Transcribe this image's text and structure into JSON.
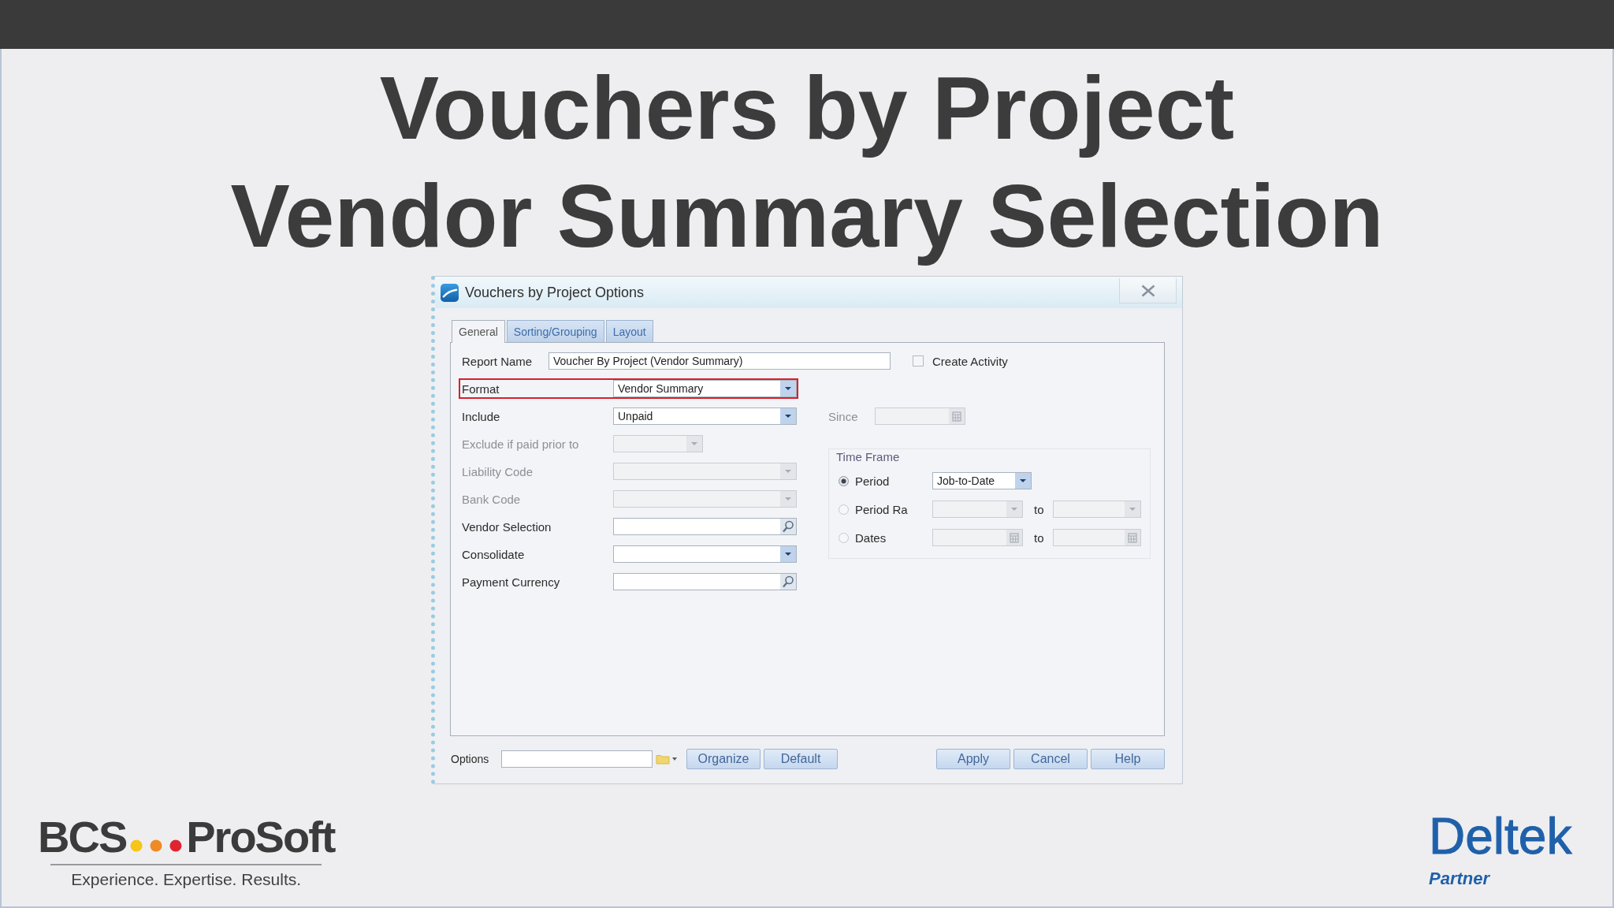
{
  "slide": {
    "title": [
      "Vouchers by Project",
      "Vendor Summary Selection"
    ]
  },
  "dialog": {
    "title": "Vouchers by Project Options",
    "tabs": [
      {
        "label": "General",
        "selected": true
      },
      {
        "label": "Sorting/Grouping",
        "selected": false
      },
      {
        "label": "Layout",
        "selected": false
      }
    ],
    "report_name": {
      "label": "Report Name",
      "value": "Voucher By Project (Vendor Summary)"
    },
    "create_activity": {
      "label": "Create Activity",
      "checked": false
    },
    "fields": [
      {
        "label": "Format",
        "kind": "dropdown",
        "value": "Vendor Summary",
        "disabled": false,
        "highlighted": true
      },
      {
        "label": "Include",
        "kind": "dropdown",
        "value": "Unpaid",
        "disabled": false,
        "highlighted": false
      },
      {
        "label": "Exclude if paid prior to",
        "kind": "small-dropdown",
        "disabled": true,
        "highlighted": false
      },
      {
        "label": "Liability Code",
        "kind": "dropdown",
        "disabled": true,
        "highlighted": false
      },
      {
        "label": "Bank Code",
        "kind": "dropdown",
        "disabled": true,
        "highlighted": false
      },
      {
        "label": "Vendor Selection",
        "kind": "lookup",
        "disabled": false,
        "highlighted": false
      },
      {
        "label": "Consolidate",
        "kind": "dropdown",
        "disabled": false,
        "highlighted": false
      },
      {
        "label": "Payment Currency",
        "kind": "lookup",
        "disabled": false,
        "highlighted": false
      }
    ],
    "since": {
      "label": "Since",
      "disabled": true
    },
    "time_frame": {
      "label": "Time Frame",
      "options": [
        {
          "label": "Period",
          "kind": "single",
          "selected": true,
          "value": "Job-to-Date"
        },
        {
          "label": "Period Ra",
          "kind": "period-range",
          "selected": false,
          "separator": "to"
        },
        {
          "label": "Dates",
          "kind": "date-range",
          "selected": false,
          "separator": "to"
        }
      ]
    },
    "options": {
      "label": "Options"
    },
    "left_buttons": [
      "Organize",
      "Default"
    ],
    "right_buttons": [
      "Apply",
      "Cancel",
      "Help"
    ]
  },
  "footer": {
    "partner_logo": {
      "parts": [
        "BCS",
        "ProSoft"
      ],
      "tagline": "Experience. Expertise. Results."
    },
    "vendor_logo": {
      "name": "Deltek",
      "tagline": "Partner"
    }
  }
}
